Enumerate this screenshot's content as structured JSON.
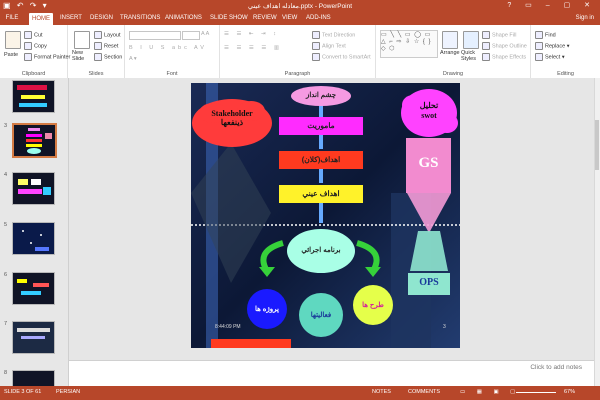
{
  "window": {
    "title": "معادله اهداف عيني.pptx - PowerPoint",
    "signin": "Sign in"
  },
  "tabs": [
    "FILE",
    "HOME",
    "INSERT",
    "DESIGN",
    "TRANSITIONS",
    "ANIMATIONS",
    "SLIDE SHOW",
    "REVIEW",
    "VIEW",
    "ADD-INS"
  ],
  "active_tab": "HOME",
  "ribbon": {
    "clipboard": {
      "paste": "Paste",
      "cut": "Cut",
      "copy": "Copy",
      "format_painter": "Format Painter",
      "label": "Clipboard"
    },
    "slides": {
      "new_slide": "New Slide",
      "layout": "Layout",
      "reset": "Reset",
      "section": "Section",
      "label": "Slides"
    },
    "font": {
      "label": "Font"
    },
    "paragraph": {
      "text_direction": "Text Direction",
      "align_text": "Align Text",
      "convert": "Convert to SmartArt",
      "label": "Paragraph"
    },
    "drawing": {
      "arrange": "Arrange",
      "quick_styles": "Quick Styles",
      "shape_fill": "Shape Fill",
      "shape_outline": "Shape Outline",
      "shape_effects": "Shape Effects",
      "label": "Drawing"
    },
    "editing": {
      "find": "Find",
      "replace": "Replace",
      "select": "Select",
      "label": "Editing"
    }
  },
  "thumbnails": [
    {
      "num": "",
      "selected": false
    },
    {
      "num": "3",
      "selected": true
    },
    {
      "num": "4",
      "selected": false
    },
    {
      "num": "5",
      "selected": false
    },
    {
      "num": "6",
      "selected": false
    },
    {
      "num": "7",
      "selected": false
    },
    {
      "num": "8",
      "selected": false
    }
  ],
  "slide": {
    "stakeholder": "Stakeholder\nذينفعها",
    "swot": "تحليل\nswot",
    "chashm": "چشم انداز",
    "mamoriat": "ماموريت",
    "ahdaf_kalan": "اهداف(كلان)",
    "ahdaf_eyni": "اهداف عيني",
    "barnameh": "برنامه اجرائي",
    "gs": "GS",
    "ops": "OPS",
    "projeha": "پروژه ها",
    "faaliatha": "فعاليتها",
    "tarhha": "طرح ها",
    "time": "8:44:09 PM",
    "page": "3"
  },
  "notes": {
    "placeholder": "Click to add notes"
  },
  "status": {
    "slide": "SLIDE 3 OF 61",
    "language": "PERSIAN",
    "notes": "NOTES",
    "comments": "COMMENTS",
    "zoom": "67%"
  },
  "colors": {
    "accent": "#b7472a"
  }
}
